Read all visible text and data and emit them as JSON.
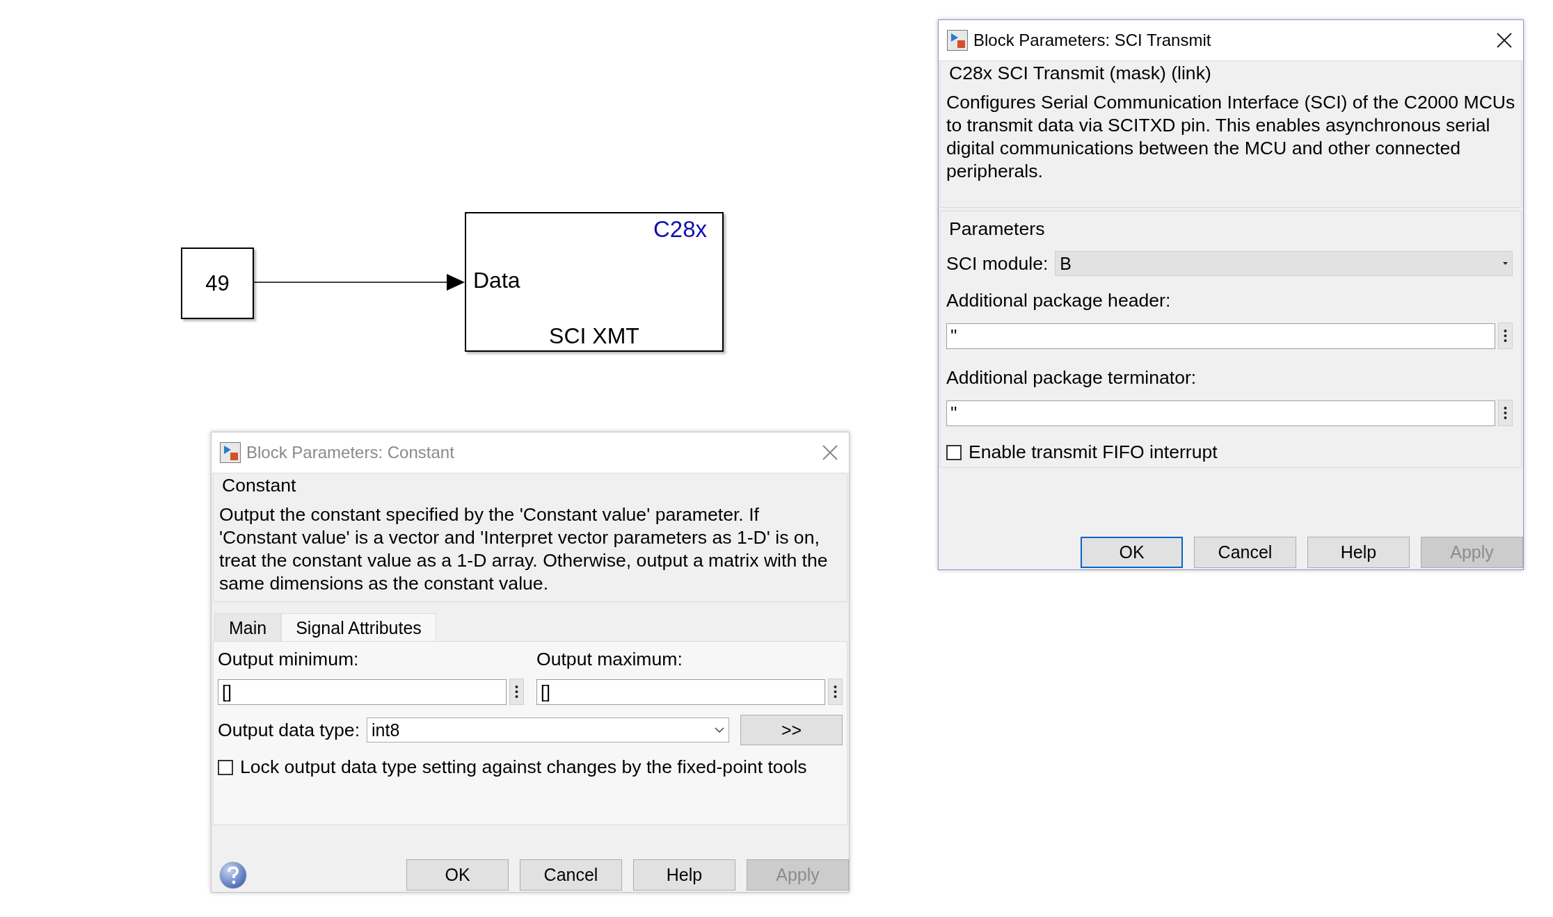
{
  "diagram": {
    "blocks": [
      {
        "kind": "constant",
        "value": "49"
      },
      {
        "kind": "target",
        "badge": "C28x",
        "port": "Data",
        "name": "SCI XMT"
      }
    ]
  },
  "dialogs": [
    {
      "kind": "sci",
      "active": true,
      "title": "Block Parameters: SCI Transmit",
      "group_title": "C28x SCI Transmit (mask) (link)",
      "description": "Configures Serial Communication Interface (SCI) of the C2000 MCUs to transmit data via SCITXD pin. This enables asynchronous serial digital communications between the MCU and other connected peripherals.",
      "parameters_title": "Parameters",
      "select": {
        "label": "SCI module:",
        "value": "B"
      },
      "fields": [
        {
          "label": "Additional package header:",
          "value": "''"
        },
        {
          "label": "Additional package terminator:",
          "value": "''"
        }
      ],
      "checkbox": {
        "label": "Enable transmit FIFO interrupt",
        "checked": false
      },
      "buttons": [
        {
          "label": "OK",
          "focused": true,
          "disabled": false
        },
        {
          "label": "Cancel",
          "focused": false,
          "disabled": false
        },
        {
          "label": "Help",
          "focused": false,
          "disabled": false
        },
        {
          "label": "Apply",
          "focused": false,
          "disabled": true
        }
      ]
    },
    {
      "kind": "constant",
      "active": false,
      "title": "Block Parameters: Constant",
      "group_title": "Constant",
      "description": "Output the constant specified by the 'Constant value' parameter. If 'Constant value' is a vector and 'Interpret vector parameters as 1-D' is on, treat the constant value as a 1-D array. Otherwise, output a matrix with the same dimensions as the constant value.",
      "tabs": [
        {
          "label": "Main",
          "selected": false
        },
        {
          "label": "Signal Attributes",
          "selected": true
        }
      ],
      "fields": [
        {
          "label": "Output minimum:",
          "value": "[]"
        },
        {
          "label": "Output maximum:",
          "value": "[]"
        }
      ],
      "select": {
        "label": "Output data type:",
        "value": "int8"
      },
      "assistant_button": ">>",
      "checkbox": {
        "label": "Lock output data type setting against changes by the fixed-point tools",
        "checked": false
      },
      "buttons": [
        {
          "label": "OK",
          "focused": false,
          "disabled": false
        },
        {
          "label": "Cancel",
          "focused": false,
          "disabled": false
        },
        {
          "label": "Help",
          "focused": false,
          "disabled": false
        },
        {
          "label": "Apply",
          "focused": false,
          "disabled": true
        }
      ]
    }
  ]
}
